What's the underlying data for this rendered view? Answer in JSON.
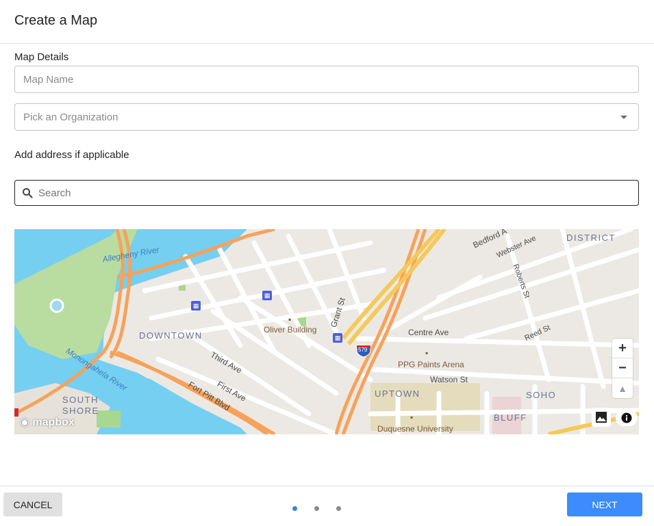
{
  "dialog": {
    "title": "Create a Map"
  },
  "details": {
    "section_label": "Map Details",
    "map_name_placeholder": "Map Name",
    "organization_placeholder": "Pick an Organization"
  },
  "address": {
    "label": "Add address if applicable",
    "search_placeholder": "Search"
  },
  "map": {
    "labels": {
      "allegheny_river": "Allegheny River",
      "monongahela_river": "Monongahela River",
      "downtown": "DOWNTOWN",
      "oliver_building": "Oliver Building",
      "grant_st": "Grant St",
      "third_ave": "Third Ave",
      "first_ave": "First Ave",
      "fort_pitt_blvd": "Fort Pitt Blvd",
      "centre_ave": "Centre Ave",
      "ppg_paints_arena": "PPG Paints Arena",
      "watson_st": "Watson St",
      "uptown": "UPTOWN",
      "soho": "SOHO",
      "bluff": "BLUFF",
      "duquesne_university": "Duquesne University",
      "south_shore_1": "SOUTH",
      "south_shore_2": "SHORE",
      "hill_district": "DISTRICT",
      "bedford_ave": "Bedford A",
      "webster_ave": "Webster Ave",
      "roberts_st": "Roberts St",
      "reed_st": "Reed St",
      "i579": "579"
    },
    "controls": {
      "zoom_in": "+",
      "zoom_out": "−",
      "compass": "▲"
    },
    "attribution_logo": "mapbox"
  },
  "footer": {
    "cancel_label": "CANCEL",
    "next_label": "NEXT",
    "steps": {
      "total": 3,
      "current": 1
    }
  },
  "colors": {
    "water": "#75cff0",
    "park": "#a8d88f",
    "land": "#ece9e4",
    "highway": "#f7a25a",
    "primary_button": "#3d8bfd"
  }
}
